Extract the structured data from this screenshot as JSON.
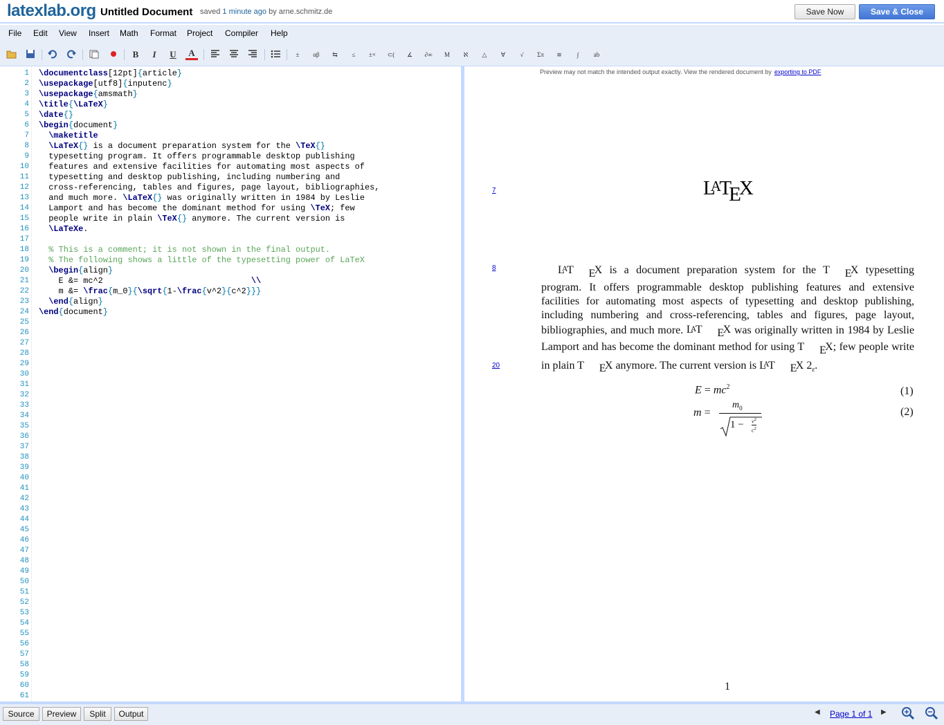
{
  "header": {
    "logo": "latexlab.org",
    "document_title": "Untitled Document",
    "saved_prefix": "saved",
    "saved_ago": "1 minute ago",
    "saved_by": "by arne.schmitz.de",
    "save_now_label": "Save Now",
    "save_close_label": "Save & Close"
  },
  "menu": [
    "File",
    "Edit",
    "View",
    "Insert",
    "Math",
    "Format",
    "Project",
    "Compiler",
    "Help"
  ],
  "toolbar": {
    "icons": [
      "open-folder-icon",
      "save-disk-icon",
      "undo-icon",
      "redo-icon",
      "page-setup-icon",
      "record-icon",
      "bold-icon",
      "italic-icon",
      "underline-icon",
      "text-color-icon",
      "align-left-icon",
      "align-center-icon",
      "align-right-icon",
      "bulleted-list-icon",
      "math-symbol-icon",
      "math-symbol-icon",
      "math-symbol-icon",
      "math-symbol-icon",
      "math-symbol-icon",
      "math-symbol-icon",
      "math-symbol-icon",
      "math-symbol-icon",
      "math-symbol-icon",
      "math-symbol-icon",
      "math-symbol-icon",
      "math-symbol-icon",
      "math-symbol-icon",
      "math-symbol-icon",
      "math-symbol-icon",
      "math-symbol-icon",
      "math-symbol-icon"
    ],
    "format_glyphs": {
      "bold": "B",
      "italic": "I",
      "underline": "U",
      "color": "A"
    }
  },
  "editor": {
    "line_count": 61,
    "lines": [
      "\\documentclass[12pt]{article}",
      "\\usepackage[utf8]{inputenc}",
      "\\usepackage{amsmath}",
      "\\title{\\LaTeX}",
      "\\date{}",
      "\\begin{document}",
      "  \\maketitle",
      "  \\LaTeX{} is a document preparation system for the \\TeX{}",
      "  typesetting program. It offers programmable desktop publishing",
      "  features and extensive facilities for automating most aspects of",
      "  typesetting and desktop publishing, including numbering and",
      "  cross-referencing, tables and figures, page layout, bibliographies,",
      "  and much more. \\LaTeX{} was originally written in 1984 by Leslie",
      "  Lamport and has become the dominant method for using \\TeX; few",
      "  people write in plain \\TeX{} anymore. The current version is",
      "  \\LaTeXe.",
      "",
      "  % This is a comment; it is not shown in the final output.",
      "  % The following shows a little of the typesetting power of LaTeX",
      "  \\begin{align}",
      "    E &= mc^2                              \\\\",
      "    m &= \\frac{m_0}{\\sqrt{1-\\frac{v^2}{c^2}}}",
      "  \\end{align}",
      "\\end{document}"
    ]
  },
  "preview": {
    "notice": "Preview may not match the intended output exactly. View the rendered document by",
    "notice_link": "exporting to PDF",
    "line_links": [
      "7",
      "8",
      "20"
    ],
    "title_logo": "LaTeX",
    "paragraph": {
      "p1": "is a document preparation system for the",
      "p2": "typesetting program. It offers programmable desktop publishing features and extensive facilities for automating most aspects of typesetting and desktop publishing, including numbering and cross-referencing, tables and figures, page layout, bibliographies, and much more.",
      "p3": "was originally written in 1984 by Leslie Lamport and has become the dominant method for using",
      "p4": "; few people write in plain",
      "p5": "anymore. The current version is",
      "p6": "."
    },
    "equations": [
      {
        "number": "(1)"
      },
      {
        "number": "(2)"
      }
    ],
    "page_number": "1"
  },
  "statusbar": {
    "buttons": [
      "Source",
      "Preview",
      "Split",
      "Output"
    ],
    "pager": "Page 1 of 1"
  }
}
